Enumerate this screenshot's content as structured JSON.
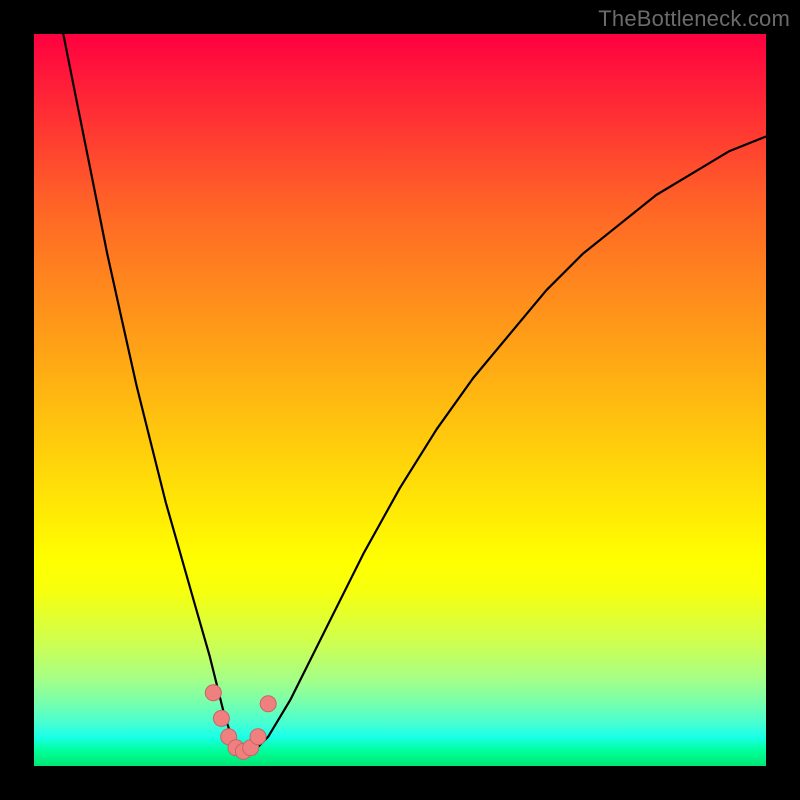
{
  "watermark": "TheBottleneck.com",
  "colors": {
    "frame": "#000000",
    "curve": "#000000",
    "dot_fill": "#f08080",
    "dot_stroke": "#c86464"
  },
  "chart_data": {
    "type": "line",
    "title": "",
    "xlabel": "",
    "ylabel": "",
    "xlim": [
      0,
      100
    ],
    "ylim": [
      0,
      100
    ],
    "series": [
      {
        "name": "bottleneck-curve",
        "x": [
          4,
          6,
          8,
          10,
          12,
          14,
          16,
          18,
          20,
          22,
          24,
          25,
          26,
          27,
          28,
          29,
          30,
          32,
          35,
          40,
          45,
          50,
          55,
          60,
          65,
          70,
          75,
          80,
          85,
          90,
          95,
          100
        ],
        "y": [
          100,
          90,
          80,
          70,
          61,
          52,
          44,
          36,
          29,
          22,
          15,
          11,
          7,
          4,
          2,
          2,
          2,
          4,
          9,
          19,
          29,
          38,
          46,
          53,
          59,
          65,
          70,
          74,
          78,
          81,
          84,
          86
        ]
      }
    ],
    "highlight_points": {
      "name": "optimal-range-dots",
      "x": [
        24.5,
        25.6,
        26.6,
        27.6,
        28.6,
        29.6,
        30.6,
        32.0
      ],
      "y": [
        10.0,
        6.5,
        4.0,
        2.5,
        2.0,
        2.5,
        4.0,
        8.5
      ]
    }
  }
}
